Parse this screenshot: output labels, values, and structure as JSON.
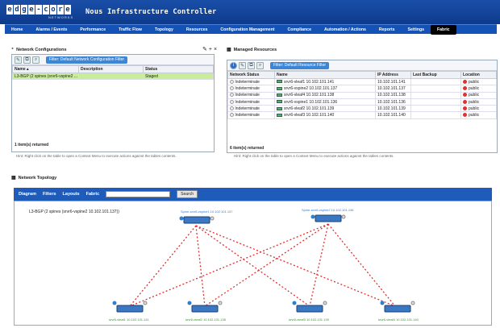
{
  "header": {
    "logo_letters": [
      "e",
      "d",
      "g",
      "e",
      "-",
      "c",
      "o",
      "r",
      "e"
    ],
    "logo_sub": "NETWORKS",
    "title": "Nous Infrastructure Controller"
  },
  "nav": [
    "Home",
    "Alarms / Events",
    "Performance",
    "Traffic Flow",
    "Topology",
    "Resources",
    "Configuration Management",
    "Compliance",
    "Automation / Actions",
    "Reports",
    "Settings",
    "Fabric"
  ],
  "nav_active": "Fabric",
  "netconf": {
    "title": "Network Configurations",
    "filter": "Filter: Default Network Configuration Filter",
    "columns": [
      "Name ▴",
      "Description",
      "Status"
    ],
    "rows": [
      [
        "L3-BGP (2 spines (srvr6-vspine2 ...",
        "",
        "Staged"
      ]
    ],
    "footer": "1 item(s) returned",
    "hint": "Hint: Right click on the table to open a Context Menu to execute actions against the tables contents."
  },
  "managed": {
    "title": "Managed Resources",
    "filter": "Filter: Default Resource Filter",
    "columns": [
      "Network Status",
      "Name",
      "IP Address",
      "Last Backup",
      "Location"
    ],
    "rows": [
      [
        "Indeterminate",
        "srvr6-vleaf1 10.102.101.141",
        "10.102.101.141",
        "",
        "public"
      ],
      [
        "Indeterminate",
        "srvr6-vspine2 10.102.101.137",
        "10.102.101.137",
        "",
        "public"
      ],
      [
        "Indeterminate",
        "srvr6-vleaf4 10.102.101.138",
        "10.102.101.138",
        "",
        "public"
      ],
      [
        "Indeterminate",
        "srvr6-vspine1 10.102.101.136",
        "10.102.101.136",
        "",
        "public"
      ],
      [
        "Indeterminate",
        "srvr6-vleaf2 10.102.101.139",
        "10.102.101.139",
        "",
        "public"
      ],
      [
        "Indeterminate",
        "srvr6-vleaf3 10.102.101.140",
        "10.102.101.140",
        "",
        "public"
      ]
    ],
    "footer": "6 item(s) returned",
    "hint": "Hint: Right click on the table to open a Context Menu to execute actions against the tables contents."
  },
  "topology": {
    "title": "Network Topology",
    "menu": [
      "Diagram",
      "Filters",
      "Layouts",
      "Fabric"
    ],
    "search_button": "Search",
    "caption": "L3-BGP (2 spines (srvr6-vspine2 10.102.101.137))",
    "spines": [
      "Spine-srvr6-vspine1 10.102.101.137",
      "Spine-srvr6-vspine2 10.102.101.136"
    ],
    "leaves": [
      "srvr6-vleaf1 10.102.101.141",
      "srvr6-vleaf2 10.102.101.138",
      "srvr6-vleaf3 10.102.101.139",
      "srvr6-vleaf4 10.102.101.140"
    ]
  }
}
